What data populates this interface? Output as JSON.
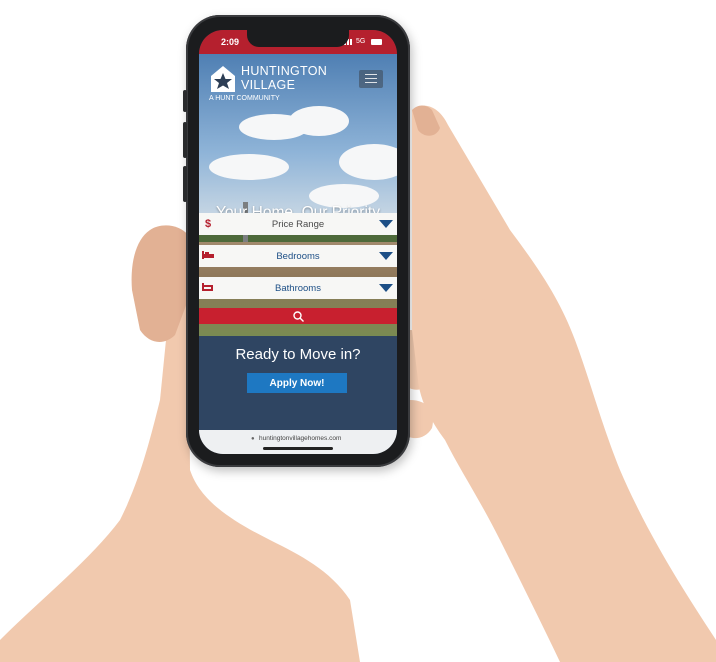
{
  "status": {
    "time": "2:09",
    "network": "5G"
  },
  "brand": {
    "name_line1": "HUNTINGTON",
    "name_line2": "VILLAGE",
    "tagline": "A HUNT COMMUNITY"
  },
  "hero": {
    "headline": "Your Home. Our Priority"
  },
  "filters": [
    {
      "label": "Price Range",
      "icon": "dollar-icon"
    },
    {
      "label": "Bedrooms",
      "icon": "bed-icon"
    },
    {
      "label": "Bathrooms",
      "icon": "bath-icon"
    }
  ],
  "cta": {
    "heading": "Ready to Move in?",
    "button_label": "Apply Now!"
  },
  "browser": {
    "url": "huntingtonvillagehomes.com"
  },
  "colors": {
    "accent_red": "#b5202e",
    "nav_blue": "#1d4f86",
    "button_blue": "#1e78c2",
    "cta_bg": "#2f4562"
  }
}
